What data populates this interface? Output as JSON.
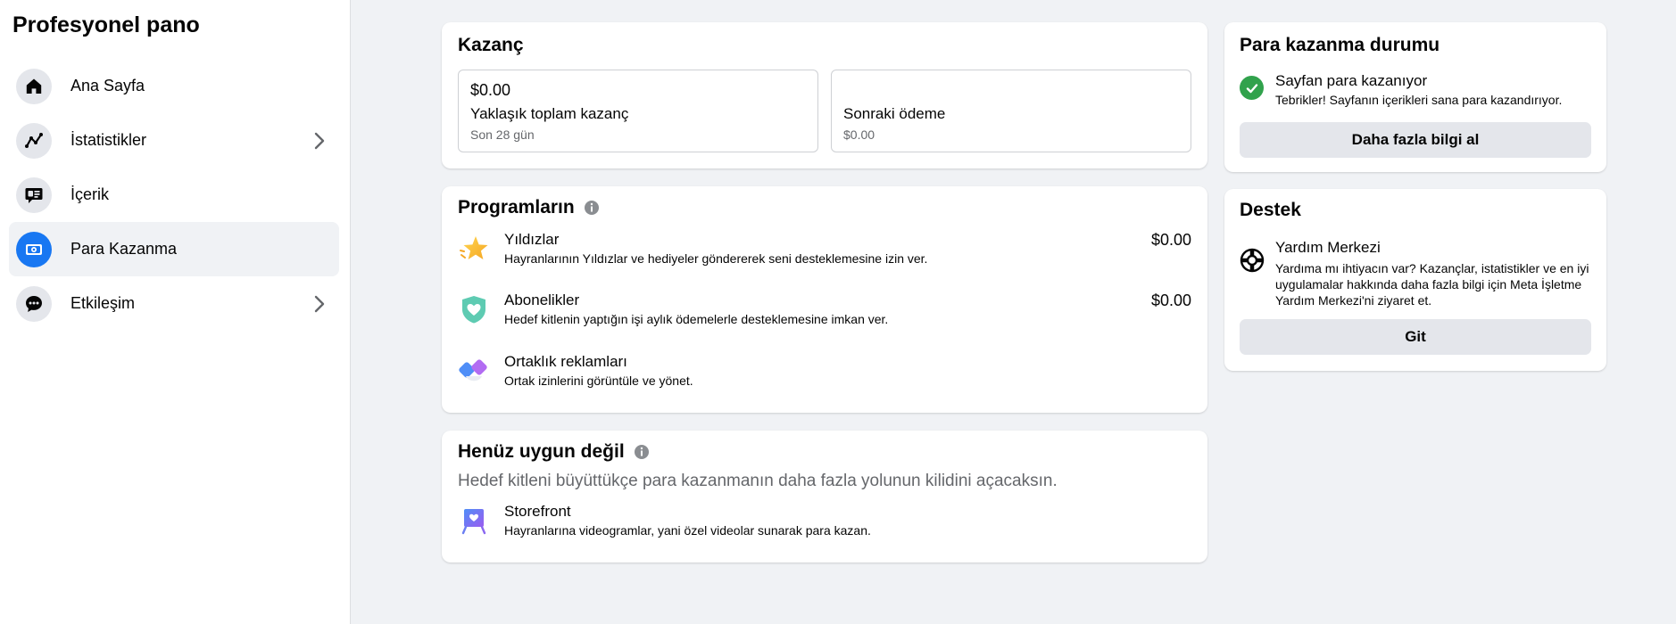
{
  "sidebar": {
    "title": "Profesyonel pano",
    "items": [
      {
        "label": "Ana Sayfa",
        "icon": "home-icon",
        "active": false,
        "chevron": false
      },
      {
        "label": "İstatistikler",
        "icon": "insights-icon",
        "active": false,
        "chevron": true
      },
      {
        "label": "İçerik",
        "icon": "content-icon",
        "active": false,
        "chevron": false
      },
      {
        "label": "Para Kazanma",
        "icon": "money-icon",
        "active": true,
        "chevron": false
      },
      {
        "label": "Etkileşim",
        "icon": "chat-icon",
        "active": false,
        "chevron": true
      }
    ]
  },
  "earnings": {
    "title": "Kazanç",
    "total": {
      "value": "$0.00",
      "label": "Yaklaşık toplam kazanç",
      "sub": "Son 28 gün"
    },
    "next_payment": {
      "value": "",
      "label": "Sonraki ödeme",
      "sub": "$0.00"
    }
  },
  "programs": {
    "title": "Programların",
    "items": [
      {
        "name": "Yıldızlar",
        "desc": "Hayranlarının Yıldızlar ve hediyeler göndererek seni desteklemesine izin ver.",
        "amount": "$0.00",
        "icon": "star-icon"
      },
      {
        "name": "Abonelikler",
        "desc": "Hedef kitlenin yaptığın işi aylık ödemelerle desteklemesine imkan ver.",
        "amount": "$0.00",
        "icon": "subscription-heart-icon"
      },
      {
        "name": "Ortaklık reklamları",
        "desc": "Ortak izinlerini görüntüle ve yönet.",
        "amount": "",
        "icon": "partnership-ads-icon"
      }
    ]
  },
  "not_yet": {
    "title": "Henüz uygun değil",
    "subtitle": "Hedef kitleni büyüttükçe para kazanmanın daha fazla yolunun kilidini açacaksın.",
    "items": [
      {
        "name": "Storefront",
        "desc": "Hayranlarına videogramlar, yani özel videolar sunarak para kazan.",
        "icon": "storefront-icon"
      }
    ]
  },
  "status": {
    "title": "Para kazanma durumu",
    "state_title": "Sayfan para kazanıyor",
    "state_desc": "Tebrikler! Sayfanın içerikleri sana para kazandırıyor.",
    "button": "Daha fazla bilgi al"
  },
  "support": {
    "title": "Destek",
    "item_title": "Yardım Merkezi",
    "item_desc": "Yardıma mı ihtiyacın var? Kazançlar, istatistikler ve en iyi uygulamalar hakkında daha fazla bilgi için Meta İşletme Yardım Merkezi'ni ziyaret et.",
    "button": "Git"
  },
  "colors": {
    "accent": "#1877f2",
    "success": "#31a24c",
    "page_bg": "#f0f2f5",
    "secondary_text": "#65676b"
  }
}
